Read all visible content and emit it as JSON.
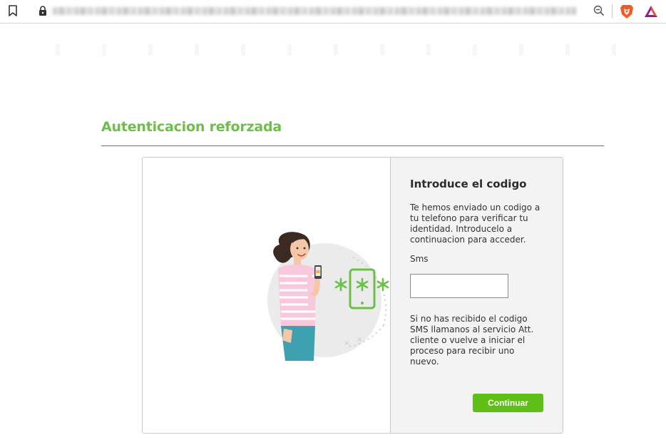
{
  "browser": {
    "bookmark_icon": "bookmark-icon",
    "lock_icon": "lock-icon",
    "zoom_icon": "zoom-out-icon",
    "extensions": [
      "brave-shield-icon",
      "brave-rewards-icon"
    ]
  },
  "page": {
    "title": "Autenticacion reforzada",
    "accent_color": "#6cc04a"
  },
  "illustration": {
    "icon": "phone-verification-illustration"
  },
  "form": {
    "heading": "Introduce el codigo",
    "description": "Te hemos enviado un codigo a tu telefono para verificar tu identidad. Introducelo a continuacion para acceder.",
    "sms_label": "Sms",
    "sms_value": "",
    "sms_placeholder": "",
    "help_text": "Si no has recibido el codigo SMS llamanos al servicio Att. cliente o vuelve a iniciar el proceso para recibir uno nuevo.",
    "continue_label": "Continuar",
    "button_color": "#5fbf16"
  }
}
